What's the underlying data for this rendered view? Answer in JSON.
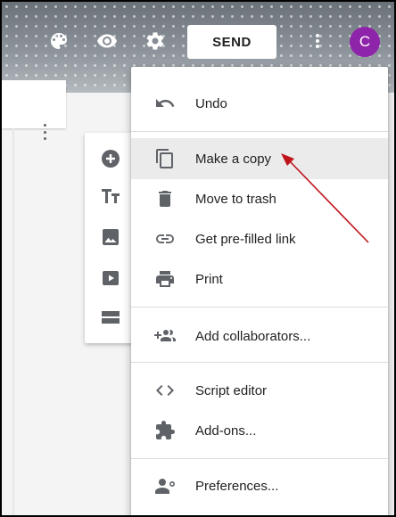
{
  "header": {
    "send_label": "SEND",
    "avatar_initial": "C",
    "avatar_color": "#8e24aa",
    "icons": [
      "palette-icon",
      "eye-icon",
      "gear-icon",
      "more-vert-icon"
    ]
  },
  "toolbar": {
    "tools": [
      "add-circle-icon",
      "title-icon",
      "image-icon",
      "video-icon",
      "section-icon"
    ]
  },
  "menu": {
    "items": [
      {
        "label": "Undo",
        "icon": "undo-icon"
      },
      {
        "label": "Make a copy",
        "icon": "copy-icon",
        "highlighted": true
      },
      {
        "label": "Move to trash",
        "icon": "trash-icon"
      },
      {
        "label": "Get pre-filled link",
        "icon": "link-icon"
      },
      {
        "label": "Print",
        "icon": "print-icon"
      },
      {
        "label": "Add collaborators...",
        "icon": "add-people-icon"
      },
      {
        "label": "Script editor",
        "icon": "code-icon"
      },
      {
        "label": "Add-ons...",
        "icon": "puzzle-icon"
      },
      {
        "label": "Preferences...",
        "icon": "person-settings-icon"
      }
    ]
  },
  "colors": {
    "annotation_arrow": "#c0141b",
    "highlight": "#ebebeb"
  }
}
